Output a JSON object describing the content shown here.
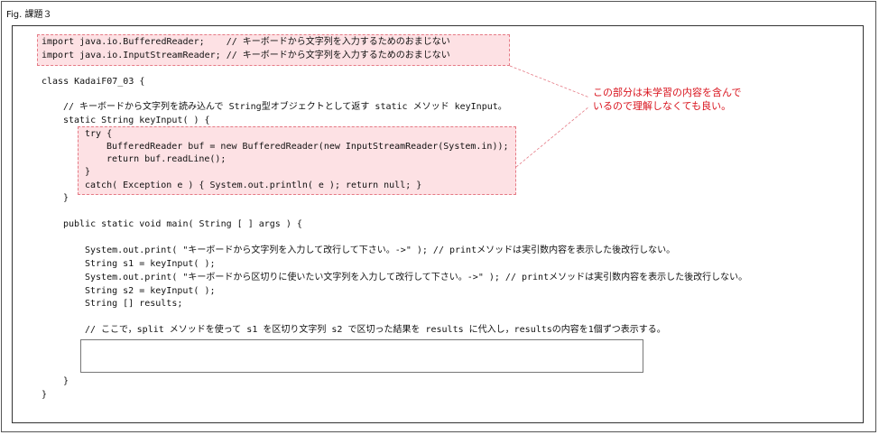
{
  "figure_label": "Fig. 課題３",
  "code_lines": [
    "import java.io.BufferedReader;    // キーボードから文字列を入力するためのおまじない",
    "import java.io.InputStreamReader; // キーボードから文字列を入力するためのおまじない",
    "class KadaiF07_03 {",
    "// キーボードから文字列を読み込んで String型オブジェクトとして返す static メソッド keyInput。",
    "static String keyInput( ) {",
    "try {",
    "BufferedReader buf = new BufferedReader(new InputStreamReader(System.in));",
    "return buf.readLine();",
    "}",
    "catch( Exception e ) { System.out.println( e ); return null; }",
    "}",
    "public static void main( String [ ] args ) {",
    "System.out.print( \"キーボードから文字列を入力して改行して下さい。->\" ); // printメソッドは実引数内容を表示した後改行しない。",
    "String s1 = keyInput( );",
    "System.out.print( \"キーボードから区切りに使いたい文字列を入力して改行して下さい。->\" ); // printメソッドは実引数内容を表示した後改行しない。",
    "String s2 = keyInput( );",
    "String [] results;",
    "// ここで，split メソッドを使って s1 を区切り文字列 s2 で区切った結果を results に代入し，resultsの内容を1個ずつ表示する。",
    "}",
    "}"
  ],
  "note_lines": [
    "この部分は未学習の内容を含んで",
    "いるので理解しなくても良い。"
  ],
  "colors": {
    "highlight_fill": "#fde1e4",
    "highlight_border": "#e57a85",
    "note_text": "#d9141e"
  }
}
